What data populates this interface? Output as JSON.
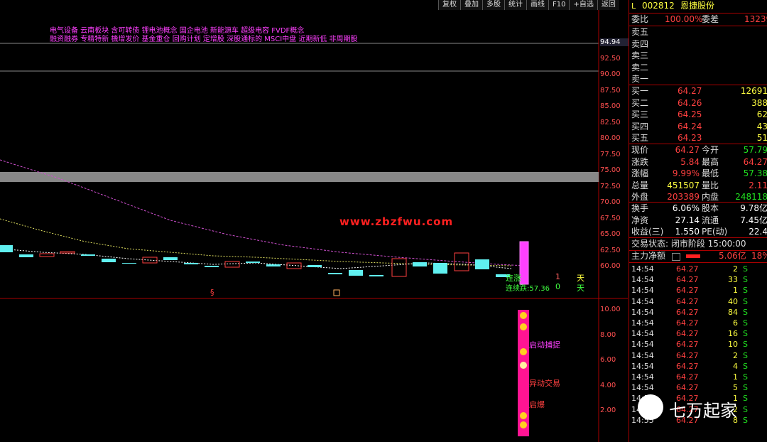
{
  "toolbar": [
    "复权",
    "叠加",
    "多股",
    "统计",
    "画线",
    "F10",
    "+自选",
    "返回"
  ],
  "concepts": {
    "row1": "电气设备 云南板块 含可转债 锂电池概念 国企电池 新能源车 超级电容 FVDF概念",
    "row2": "融资融券 专精特新 機增发价 基金重仓 回购计划 定增股 深股通标的 MSCI中盘 近期新低 非周期股"
  },
  "price_axis": [
    "94.94",
    "92.50",
    "90.00",
    "87.50",
    "85.00",
    "82.50",
    "80.00",
    "77.50",
    "75.00",
    "72.50",
    "70.00",
    "67.50",
    "65.00",
    "62.50",
    "60.00"
  ],
  "indicator_axis": [
    "10.00",
    "8.00",
    "6.00",
    "4.00",
    "2.00"
  ],
  "watermark": "www.zbzfwu.com",
  "chart_labels": {
    "lianzhang": "连涨",
    "lianzhang_val": "1",
    "lianzhang_unit": "天",
    "lianjie": "连续跌:57.36",
    "lianjie_val": "0",
    "lianjie_unit": "天",
    "marker_s": "§",
    "signal1": "启动捕捉",
    "signal2": "异动交易",
    "signal3": "启爆"
  },
  "header": {
    "flag": "L",
    "code": "002812",
    "name": "恩捷股份",
    "ratio_label": "委比",
    "ratio": "100.00%",
    "diff_label": "委差",
    "diff": "13239"
  },
  "sell": [
    {
      "label": "卖五"
    },
    {
      "label": "卖四"
    },
    {
      "label": "卖三"
    },
    {
      "label": "卖二"
    },
    {
      "label": "卖一"
    }
  ],
  "buy": [
    {
      "label": "买一",
      "price": "64.27",
      "vol": "12691"
    },
    {
      "label": "买二",
      "price": "64.26",
      "vol": "388"
    },
    {
      "label": "买三",
      "price": "64.25",
      "vol": "62"
    },
    {
      "label": "买四",
      "price": "64.24",
      "vol": "43"
    },
    {
      "label": "买五",
      "price": "64.23",
      "vol": "51"
    }
  ],
  "stats": [
    {
      "l1": "现价",
      "v1": "64.27",
      "l2": "今开",
      "v2": "57.79"
    },
    {
      "l1": "涨跌",
      "v1": "5.84",
      "l2": "最高",
      "v2": "64.27"
    },
    {
      "l1": "涨幅",
      "v1": "9.99%",
      "l2": "最低",
      "v2": "57.38"
    },
    {
      "l1": "总量",
      "v1": "451507",
      "l2": "量比",
      "v2": "2.11"
    },
    {
      "l1": "外盘",
      "v1": "203389",
      "l2": "内盘",
      "v2": "248118"
    }
  ],
  "stats2": [
    {
      "l1": "换手",
      "v1": "6.06%",
      "l2": "股本",
      "v2": "9.78亿"
    },
    {
      "l1": "净资",
      "v1": "27.14",
      "l2": "流通",
      "v2": "7.45亿"
    },
    {
      "l1": "收益(三)",
      "v1": "1.550",
      "l2": "PE(动)",
      "v2": "22.4"
    }
  ],
  "trade_status": "交易状态: 闭市阶段 15:00:00",
  "main_flow": {
    "label": "主力净额",
    "value": "5.06亿",
    "pct": "18%"
  },
  "ticks": [
    {
      "t": "14:54",
      "p": "64.27",
      "v": "2",
      "s": "S"
    },
    {
      "t": "14:54",
      "p": "64.27",
      "v": "33",
      "s": "S"
    },
    {
      "t": "14:54",
      "p": "64.27",
      "v": "1",
      "s": "S"
    },
    {
      "t": "14:54",
      "p": "64.27",
      "v": "40",
      "s": "S"
    },
    {
      "t": "14:54",
      "p": "64.27",
      "v": "84",
      "s": "S"
    },
    {
      "t": "14:54",
      "p": "64.27",
      "v": "6",
      "s": "S"
    },
    {
      "t": "14:54",
      "p": "64.27",
      "v": "16",
      "s": "S"
    },
    {
      "t": "14:54",
      "p": "64.27",
      "v": "10",
      "s": "S"
    },
    {
      "t": "14:54",
      "p": "64.27",
      "v": "2",
      "s": "S"
    },
    {
      "t": "14:54",
      "p": "64.27",
      "v": "4",
      "s": "S"
    },
    {
      "t": "14:54",
      "p": "64.27",
      "v": "1",
      "s": "S"
    },
    {
      "t": "14:54",
      "p": "64.27",
      "v": "5",
      "s": "S"
    },
    {
      "t": "14:55",
      "p": "64.27",
      "v": "1",
      "s": "S"
    },
    {
      "t": "14:55",
      "p": "64.27",
      "v": "2",
      "s": "S"
    },
    {
      "t": "14:55",
      "p": "64.27",
      "v": "8",
      "s": "S"
    }
  ],
  "brand": "七万起家"
}
